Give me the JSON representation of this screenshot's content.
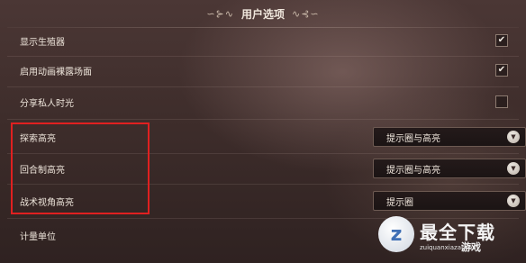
{
  "header": {
    "title": "用户选项",
    "flourish_left": "∽⊱∿",
    "flourish_right": "∿⊰∽"
  },
  "rows": [
    {
      "label": "显示生殖器",
      "control": "checkbox",
      "checked": true,
      "check_glyph": "✔"
    },
    {
      "label": "启用动画裸露场面",
      "control": "checkbox",
      "checked": true,
      "check_glyph": "✔"
    },
    {
      "label": "分享私人时光",
      "control": "checkbox",
      "checked": false,
      "check_glyph": ""
    },
    {
      "label": "探索高亮",
      "control": "dropdown",
      "value": "提示圈与高亮",
      "knob_glyph": "▼"
    },
    {
      "label": "回合制高亮",
      "control": "dropdown",
      "value": "提示圈与高亮",
      "knob_glyph": "▼"
    },
    {
      "label": "战术视角高亮",
      "control": "dropdown",
      "value": "提示圈",
      "knob_glyph": "▼"
    },
    {
      "label": "计量单位",
      "control": "none"
    }
  ],
  "watermark": {
    "logo_glyph": "z",
    "main": "最全下载",
    "sub": "zuiquanxiazai.com",
    "tag": "游戏"
  },
  "colors": {
    "highlight_border": "#e02020",
    "background": "#3e2d2b",
    "text": "#ede4da"
  }
}
